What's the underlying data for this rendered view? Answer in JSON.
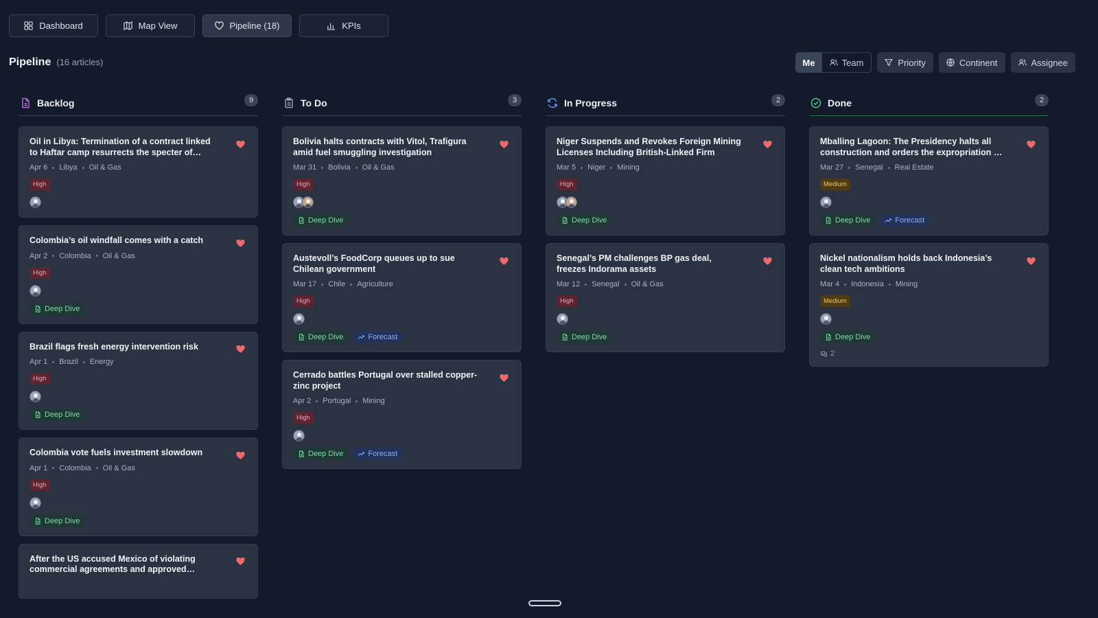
{
  "nav": {
    "tabs": [
      {
        "label": "Dashboard",
        "icon": "grid-icon"
      },
      {
        "label": "Map View",
        "icon": "map-icon"
      },
      {
        "label": "Pipeline (18)",
        "icon": "heart-icon"
      },
      {
        "label": "KPIs",
        "icon": "bar-chart-icon"
      }
    ],
    "active": "Pipeline (18)"
  },
  "header": {
    "title": "Pipeline",
    "count": "(16 articles)"
  },
  "filters": {
    "scope": {
      "me": "Me",
      "team": "Team"
    },
    "priority": "Priority",
    "continent": "Continent",
    "assignee": "Assignee"
  },
  "colors": {
    "high": "#f1a4ad",
    "medium": "#f0c766",
    "deep_dive": "#7fd6a8",
    "forecast": "#93acf5",
    "heart": "#f0696d"
  },
  "columns": [
    {
      "name": "Backlog",
      "count": "9",
      "icon": "file-icon",
      "cards": [
        {
          "title": "Oil in Libya: Termination of a contract linked to Haftar camp resurrects the specter of total...",
          "date": "Apr 6",
          "country": "Libya",
          "sector": "Oil & Gas",
          "priority": "High",
          "avatars": 1,
          "tags": [],
          "comments": ""
        },
        {
          "title": "Colombia’s oil windfall comes with a catch",
          "date": "Apr 2",
          "country": "Colombia",
          "sector": "Oil & Gas",
          "priority": "High",
          "avatars": 1,
          "tags": [
            "Deep Dive"
          ],
          "comments": ""
        },
        {
          "title": "Brazil flags fresh energy intervention risk",
          "date": "Apr 1",
          "country": "Brazil",
          "sector": "Energy",
          "priority": "High",
          "avatars": 1,
          "tags": [
            "Deep Dive"
          ],
          "comments": ""
        },
        {
          "title": "Colombia vote fuels investment slowdown",
          "date": "Apr 1",
          "country": "Colombia",
          "sector": "Oil & Gas",
          "priority": "High",
          "avatars": 1,
          "tags": [
            "Deep Dive"
          ],
          "comments": ""
        },
        {
          "title": "After the US accused Mexico of violating commercial agreements and approved sanctions...",
          "date": "",
          "country": "",
          "sector": "",
          "priority": "",
          "avatars": 0,
          "tags": [],
          "comments": ""
        }
      ]
    },
    {
      "name": "To Do",
      "count": "3",
      "icon": "clipboard-icon",
      "cards": [
        {
          "title": "Bolivia halts contracts with Vitol, Trafigura amid fuel smuggling investigation",
          "date": "Mar 31",
          "country": "Bolivia",
          "sector": "Oil & Gas",
          "priority": "High",
          "avatars": 2,
          "tags": [
            "Deep Dive"
          ],
          "comments": ""
        },
        {
          "title": "Austevoll’s FoodCorp queues up to sue Chilean government",
          "date": "Mar 17",
          "country": "Chile",
          "sector": "Agriculture",
          "priority": "High",
          "avatars": 1,
          "tags": [
            "Deep Dive",
            "Forecast"
          ],
          "comments": ""
        },
        {
          "title": "Cerrado battles Portugal over stalled copper-zinc project",
          "date": "Apr 2",
          "country": "Portugal",
          "sector": "Mining",
          "priority": "High",
          "avatars": 1,
          "tags": [
            "Deep Dive",
            "Forecast"
          ],
          "comments": ""
        }
      ]
    },
    {
      "name": "In Progress",
      "count": "2",
      "icon": "refresh-icon",
      "cards": [
        {
          "title": "Niger Suspends and Revokes Foreign Mining Licenses Including British-Linked Firm",
          "date": "Mar 5",
          "country": "Niger",
          "sector": "Mining",
          "priority": "High",
          "avatars": 2,
          "tags": [
            "Deep Dive"
          ],
          "comments": ""
        },
        {
          "title": "Senegal’s PM challenges BP gas deal, freezes Indorama assets",
          "date": "Mar 12",
          "country": "Senegal",
          "sector": "Oil & Gas",
          "priority": "High",
          "avatars": 1,
          "tags": [
            "Deep Dive"
          ],
          "comments": ""
        }
      ]
    },
    {
      "name": "Done",
      "count": "2",
      "icon": "check-circle-icon",
      "cards": [
        {
          "title": "Mballing Lagoon: The Presidency halts all construction and orders the expropriation of the...",
          "date": "Mar 27",
          "country": "Senegal",
          "sector": "Real Estate",
          "priority": "Medium",
          "avatars": 1,
          "tags": [
            "Deep Dive",
            "Forecast"
          ],
          "comments": ""
        },
        {
          "title": "Nickel nationalism holds back Indonesia’s clean tech ambitions",
          "date": "Mar 4",
          "country": "Indonesia",
          "sector": "Mining",
          "priority": "Medium",
          "avatars": 1,
          "tags": [
            "Deep Dive"
          ],
          "comments": "2"
        }
      ]
    }
  ]
}
